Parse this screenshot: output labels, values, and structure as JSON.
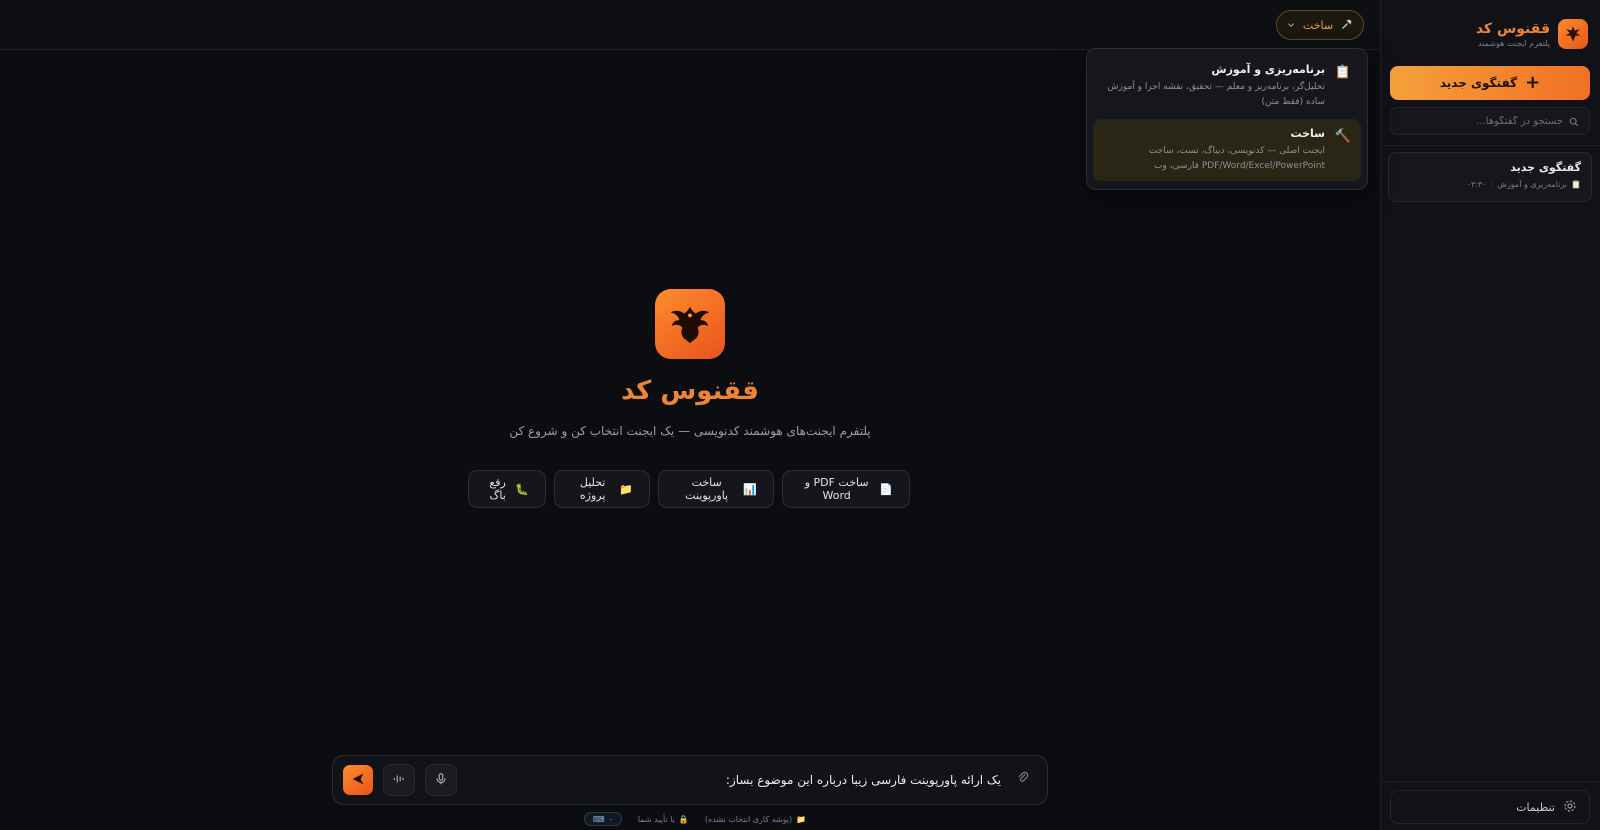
{
  "brand": {
    "name": "ققنوس کد",
    "subtitle": "پلتفرم ایجنت هوشمند"
  },
  "sidebar": {
    "new_chat_label": "گفتگوی جدید",
    "search_placeholder": "جستجو در گفتگوها...",
    "conversations": [
      {
        "title": "گفتگوی جدید",
        "agent": "برنامه‌ریزی و آموزش",
        "time": "۰۳:۳۰"
      }
    ],
    "settings_label": "تنظیمات"
  },
  "topbar": {
    "agent_selected": "ساخت"
  },
  "agent_menu": [
    {
      "title": "برنامه‌ریزی و آموزش",
      "desc": "تحلیل‌گر، برنامه‌ریز و معلم — تحقیق، نقشه اجرا و آموزش ساده (فقط متن)",
      "icon": "clipboard-icon",
      "active": false
    },
    {
      "title": "ساخت",
      "desc": "ایجنت اصلی — کدنویسی، دیباگ، تست، ساخت PDF/Word/Excel/PowerPoint فارسی، وب",
      "icon": "hammer-icon",
      "active": true
    }
  ],
  "hero": {
    "title": "ققنوس کد",
    "subtitle": "پلتفرم ایجنت‌های هوشمند کدنویسی — یک ایجنت انتخاب کن و شروع کن"
  },
  "quick_actions": [
    {
      "label": "ساخت PDF و Word",
      "emoji": "📄"
    },
    {
      "label": "ساخت پاورپوینت",
      "emoji": "📊"
    },
    {
      "label": "تحلیل پروژه",
      "emoji": "📁"
    },
    {
      "label": "رفع باگ",
      "emoji": "🐛"
    }
  ],
  "composer": {
    "value": "یک ارائه پاورپوینت فارسی زیبا درباره این موضوع بساز:"
  },
  "status": {
    "workspace": "(پوشه کاری انتخاب نشده)",
    "approval": "با تأیید شما",
    "tokens": "۰"
  },
  "colors": {
    "accent": "#f08436",
    "background": "#0c0d11",
    "sidebar": "#111217"
  }
}
